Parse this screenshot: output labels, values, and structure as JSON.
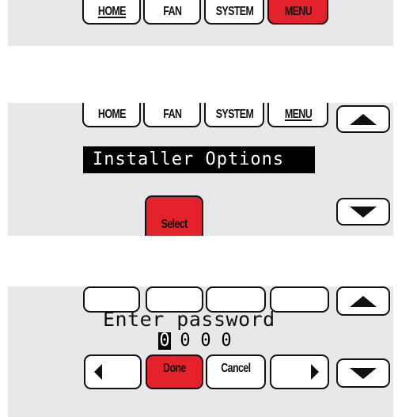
{
  "screen1": {
    "tabs": [
      "HOME",
      "FAN",
      "SYSTEM",
      "MENU"
    ]
  },
  "screen2": {
    "tabs": [
      "HOME",
      "FAN",
      "SYSTEM",
      "MENU"
    ],
    "banner": "Installer Options",
    "select_label": "Select",
    "up_icon": "triangle-up-icon",
    "down_icon": "triangle-down-icon"
  },
  "screen3": {
    "prompt": "Enter password",
    "digits": [
      "0",
      "0",
      "0",
      "0"
    ],
    "done_label": "Done",
    "cancel_label": "Cancel",
    "icons": [
      "triangle-up-icon",
      "triangle-left-icon",
      "triangle-right-icon",
      "triangle-down-icon"
    ]
  },
  "colors": {
    "panel": "#e7e8e9",
    "accent_red": "#e3222b",
    "border": "#111111"
  }
}
